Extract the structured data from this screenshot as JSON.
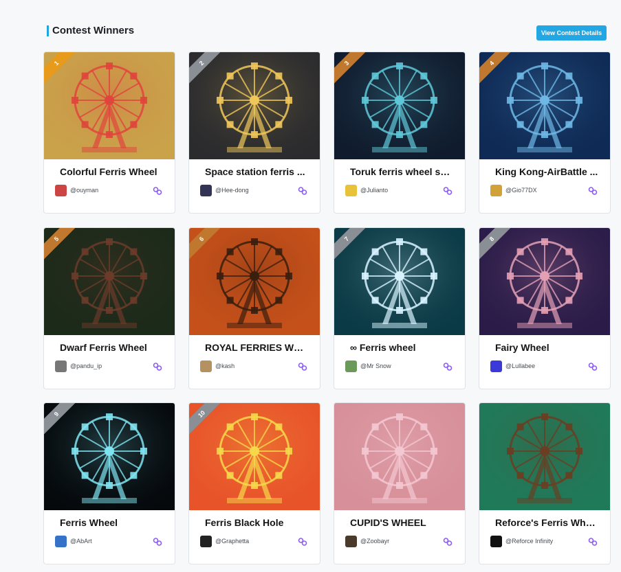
{
  "header": {
    "title": "Contest Winners",
    "view_button": "View Contest Details"
  },
  "colors": {
    "accent": "#22a7e4",
    "rank_gold": "#e89b1a",
    "rank_silver": "#8a8f96",
    "rank_bronze": "#c0782e",
    "link_icon": "#8b5cf6"
  },
  "cards": [
    {
      "rank": "1",
      "title": "Colorful Ferris Wheel",
      "author": "@ouyman",
      "thumb_icon": "colorful-ferris-wheel-image",
      "bg": "#c9a24a",
      "accent": "#e0443c"
    },
    {
      "rank": "2",
      "title": "Space station ferris ...",
      "author": "@Hee-dong",
      "thumb_icon": "space-station-ferris-image",
      "bg": "#2b2b2e",
      "accent": "#f0c75a"
    },
    {
      "rank": "3",
      "title": "Toruk ferris wheel sn...",
      "author": "@Julianto",
      "thumb_icon": "toruk-ferris-wheel-image",
      "bg": "#101c2e",
      "accent": "#5fc8d8"
    },
    {
      "rank": "4",
      "title": "King Kong-AirBattle ...",
      "author": "@Gio77DX",
      "thumb_icon": "king-kong-airbattle-image",
      "bg": "#0e2a55",
      "accent": "#6fb8e6"
    },
    {
      "rank": "5",
      "title": "Dwarf Ferris Wheel",
      "author": "@pandu_ip",
      "thumb_icon": "dwarf-ferris-wheel-image",
      "bg": "#1c2a1a",
      "accent": "#6b3b2a"
    },
    {
      "rank": "6",
      "title": "ROYAL FERRIES WH...",
      "author": "@kash",
      "thumb_icon": "royal-ferries-wheel-image",
      "bg": "#c5501a",
      "accent": "#3a1e0e"
    },
    {
      "rank": "7",
      "title": "∞ Ferris wheel",
      "author": "@Mr Snow",
      "thumb_icon": "infinity-ferris-wheel-image",
      "bg": "#0a3a45",
      "accent": "#d8f3ff"
    },
    {
      "rank": "8",
      "title": "Fairy Wheel",
      "author": "@Lullabee",
      "thumb_icon": "fairy-wheel-image",
      "bg": "#2a1b48",
      "accent": "#e3a0b5"
    },
    {
      "rank": "9",
      "title": "Ferris Wheel",
      "author": "@AbArt",
      "thumb_icon": "neon-ferris-wheel-image",
      "bg": "#05090c",
      "accent": "#7fe3f0"
    },
    {
      "rank": "10",
      "title": "Ferris Black Hole",
      "author": "@Graphetta",
      "thumb_icon": "ferris-black-hole-image",
      "bg": "#e8532a",
      "accent": "#f6d84a"
    },
    {
      "rank": "",
      "title": "CUPID'S WHEEL",
      "author": "@Zoobayr",
      "thumb_icon": "cupids-wheel-image",
      "bg": "#d7909a",
      "accent": "#f3c8d2"
    },
    {
      "rank": "",
      "title": "Reforce's Ferris Whe...",
      "author": "@Reforce Infinity",
      "thumb_icon": "reforce-ferris-wheel-image",
      "bg": "#1f7a5a",
      "accent": "#6a3e22"
    }
  ]
}
